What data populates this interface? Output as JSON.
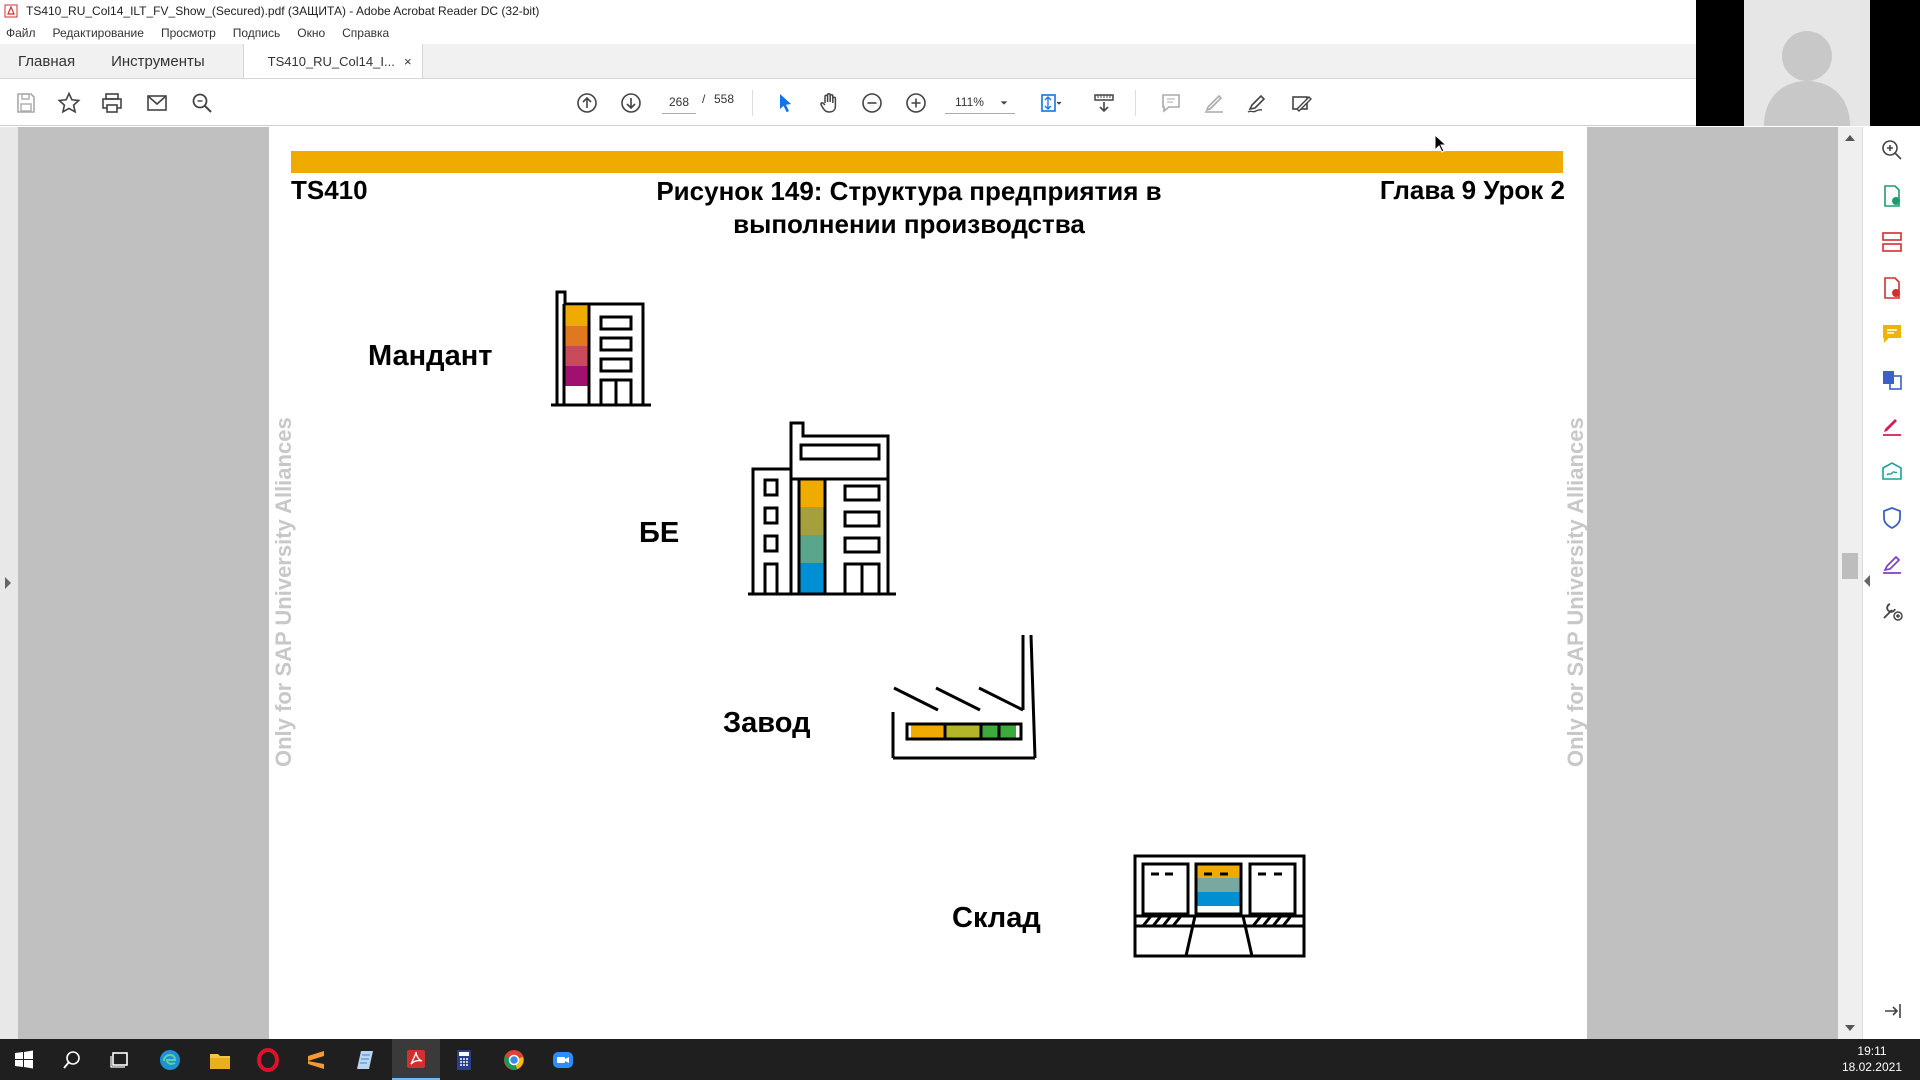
{
  "window": {
    "title": "TS410_RU_Col14_ILT_FV_Show_(Secured).pdf (ЗАЩИТА) - Adobe Acrobat Reader DC (32-bit)"
  },
  "menu": [
    "Файл",
    "Редактирование",
    "Просмотр",
    "Подпись",
    "Окно",
    "Справка"
  ],
  "tabs": {
    "home": "Главная",
    "tools": "Инструменты",
    "document": "TS410_RU_Col14_I...",
    "close": "×"
  },
  "toolbar": {
    "current_page": "268",
    "separator": "/",
    "total_pages": "558",
    "zoom": "111%"
  },
  "document": {
    "course": "TS410",
    "figure_title_line1": "Рисунок 149: Структура предприятия в",
    "figure_title_line2": "выполнении производства",
    "chapter": "Глава 9 Урок 2",
    "watermark": "Only for SAP University Alliances",
    "accent_color": "#f0ab00",
    "levels": [
      {
        "label": "Мандант",
        "icon": "building-icon"
      },
      {
        "label": "БЕ",
        "icon": "office-building-icon"
      },
      {
        "label": "Завод",
        "icon": "factory-icon"
      },
      {
        "label": "Склад",
        "icon": "warehouse-icon"
      }
    ]
  },
  "taskbar": {
    "time": "19:11",
    "date": "18.02.2021",
    "apps": [
      "windows-start",
      "search",
      "task-view",
      "edge",
      "file-explorer",
      "opera",
      "sublime",
      "notepad",
      "acrobat",
      "calculator",
      "chrome",
      "zoom"
    ]
  }
}
